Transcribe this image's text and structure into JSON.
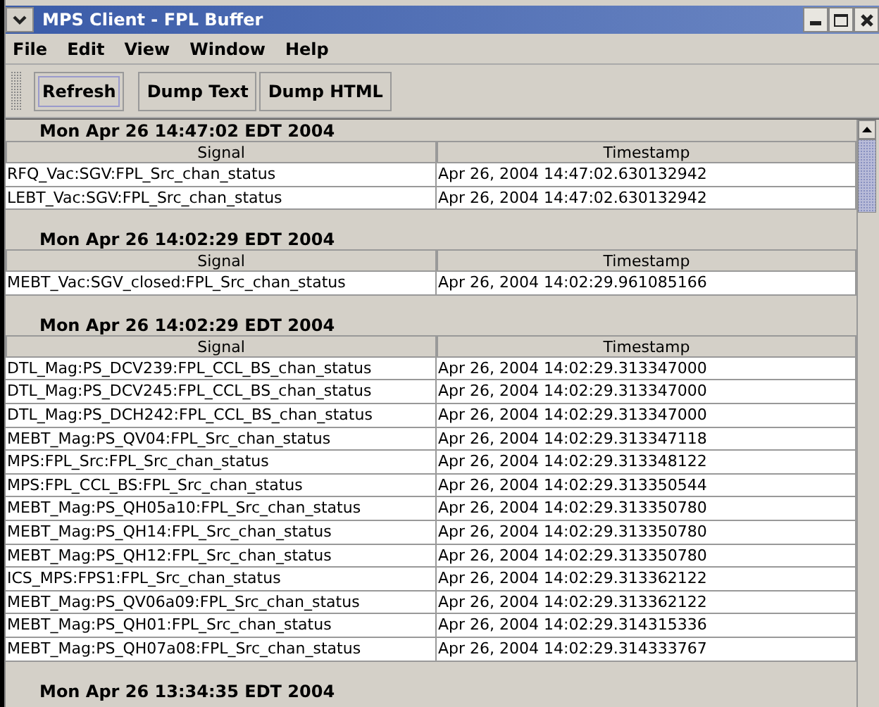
{
  "window": {
    "title": "MPS Client - FPL Buffer"
  },
  "menu": [
    "File",
    "Edit",
    "View",
    "Window",
    "Help"
  ],
  "toolbar": [
    {
      "label": "Refresh",
      "selected": true
    },
    {
      "label": "Dump Text",
      "selected": false
    },
    {
      "label": "Dump HTML",
      "selected": false
    }
  ],
  "groups": [
    {
      "title": "Mon Apr 26 14:47:02 EDT 2004",
      "columns": [
        "Signal",
        "Timestamp"
      ],
      "rows": [
        [
          "RFQ_Vac:SGV:FPL_Src_chan_status",
          "Apr 26, 2004 14:47:02.630132942"
        ],
        [
          "LEBT_Vac:SGV:FPL_Src_chan_status",
          "Apr 26, 2004 14:47:02.630132942"
        ]
      ]
    },
    {
      "title": "Mon Apr 26 14:02:29 EDT 2004",
      "columns": [
        "Signal",
        "Timestamp"
      ],
      "rows": [
        [
          "MEBT_Vac:SGV_closed:FPL_Src_chan_status",
          "Apr 26, 2004 14:02:29.961085166"
        ]
      ]
    },
    {
      "title": "Mon Apr 26 14:02:29 EDT 2004",
      "columns": [
        "Signal",
        "Timestamp"
      ],
      "rows": [
        [
          "DTL_Mag:PS_DCV239:FPL_CCL_BS_chan_status",
          "Apr 26, 2004 14:02:29.313347000"
        ],
        [
          "DTL_Mag:PS_DCV245:FPL_CCL_BS_chan_status",
          "Apr 26, 2004 14:02:29.313347000"
        ],
        [
          "DTL_Mag:PS_DCH242:FPL_CCL_BS_chan_status",
          "Apr 26, 2004 14:02:29.313347000"
        ],
        [
          "MEBT_Mag:PS_QV04:FPL_Src_chan_status",
          "Apr 26, 2004 14:02:29.313347118"
        ],
        [
          "MPS:FPL_Src:FPL_Src_chan_status",
          "Apr 26, 2004 14:02:29.313348122"
        ],
        [
          "MPS:FPL_CCL_BS:FPL_Src_chan_status",
          "Apr 26, 2004 14:02:29.313350544"
        ],
        [
          "MEBT_Mag:PS_QH05a10:FPL_Src_chan_status",
          "Apr 26, 2004 14:02:29.313350780"
        ],
        [
          "MEBT_Mag:PS_QH14:FPL_Src_chan_status",
          "Apr 26, 2004 14:02:29.313350780"
        ],
        [
          "MEBT_Mag:PS_QH12:FPL_Src_chan_status",
          "Apr 26, 2004 14:02:29.313350780"
        ],
        [
          "ICS_MPS:FPS1:FPL_Src_chan_status",
          "Apr 26, 2004 14:02:29.313362122"
        ],
        [
          "MEBT_Mag:PS_QV06a09:FPL_Src_chan_status",
          "Apr 26, 2004 14:02:29.313362122"
        ],
        [
          "MEBT_Mag:PS_QH01:FPL_Src_chan_status",
          "Apr 26, 2004 14:02:29.314315336"
        ],
        [
          "MEBT_Mag:PS_QH07a08:FPL_Src_chan_status",
          "Apr 26, 2004 14:02:29.314333767"
        ]
      ]
    },
    {
      "title": "Mon Apr 26 13:34:35 EDT 2004"
    }
  ]
}
